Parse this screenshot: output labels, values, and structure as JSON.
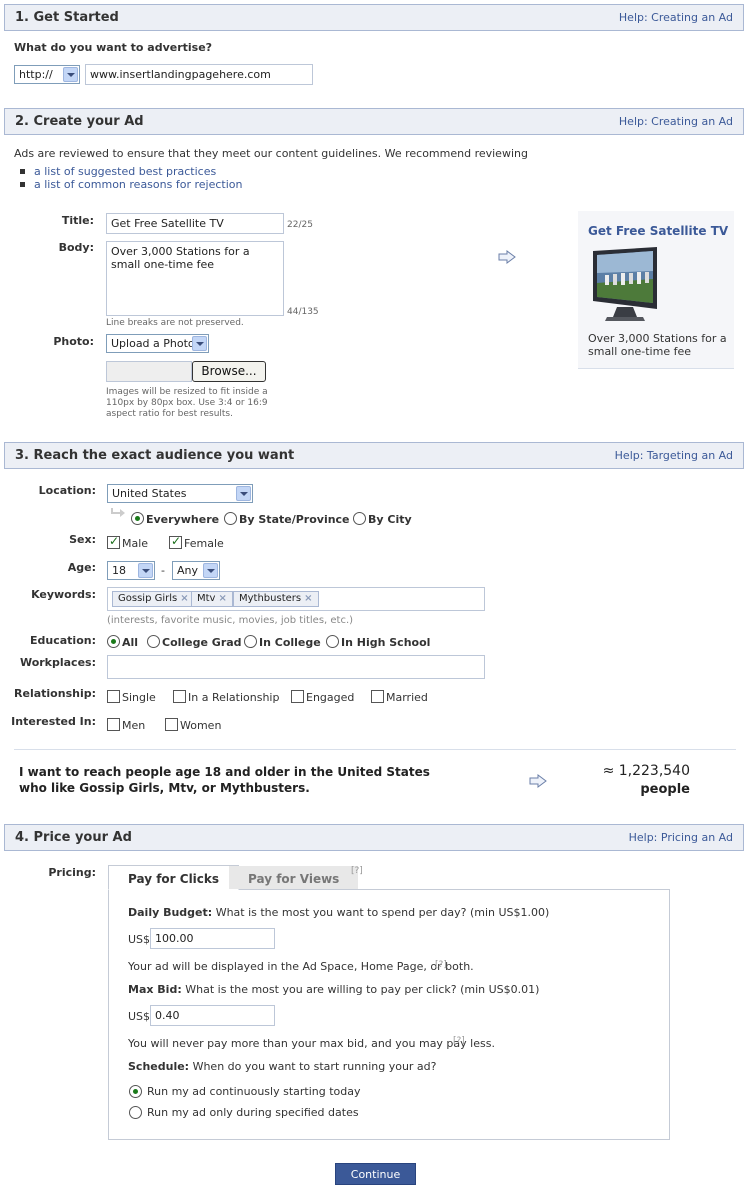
{
  "section1": {
    "title": "1. Get Started",
    "help": "Help: Creating an Ad",
    "question": "What do you want to advertise?",
    "protocol": "http://",
    "url": "www.insertlandingpagehere.com"
  },
  "section2": {
    "title": "2. Create your Ad",
    "help": "Help: Creating an Ad",
    "intro": "Ads are reviewed to ensure that they meet our content guidelines. We recommend reviewing",
    "links": [
      "a list of suggested best practices",
      "a list of common reasons for rejection"
    ],
    "title_label": "Title:",
    "title_value": "Get Free Satellite TV",
    "title_count": "22/25",
    "body_label": "Body:",
    "body_value": "Over 3,000 Stations for a small one-time fee",
    "body_count": "44/135",
    "body_note": "Line breaks are not preserved.",
    "photo_label": "Photo:",
    "photo_select": "Upload a Photo",
    "browse_label": "Browse...",
    "photo_note": "Images will be resized to fit inside a 110px by 80px box. Use 3:4 or 16:9 aspect ratio for best results.",
    "preview_title": "Get Free Satellite TV",
    "preview_body": "Over 3,000 Stations for a small one-time fee"
  },
  "section3": {
    "title": "3. Reach the exact audience you want",
    "help": "Help: Targeting an Ad",
    "location_label": "Location:",
    "location_value": "United States",
    "location_options": [
      "Everywhere",
      "By State/Province",
      "By City"
    ],
    "sex_label": "Sex:",
    "sex_options": [
      "Male",
      "Female"
    ],
    "age_label": "Age:",
    "age_min": "18",
    "age_dash": "-",
    "age_max": "Any",
    "keywords_label": "Keywords:",
    "keywords": [
      "Gossip Girls",
      "Mtv",
      "Mythbusters"
    ],
    "keywords_hint": "(interests, favorite music, movies, job titles, etc.)",
    "education_label": "Education:",
    "education_options": [
      "All",
      "College Grad",
      "In College",
      "In High School"
    ],
    "workplaces_label": "Workplaces:",
    "relationship_label": "Relationship:",
    "relationship_options": [
      "Single",
      "In a Relationship",
      "Engaged",
      "Married"
    ],
    "interested_label": "Interested In:",
    "interested_options": [
      "Men",
      "Women"
    ],
    "summary_line1": "I want to reach people age 18 and older in the United States",
    "summary_line2": "who like Gossip Girls, Mtv, or Mythbusters.",
    "reach_count": "≈ 1,223,540",
    "reach_unit": "people"
  },
  "section4": {
    "title": "4. Price your Ad",
    "help": "Help: Pricing an Ad",
    "pricing_label": "Pricing:",
    "tab_clicks": "Pay for Clicks",
    "tab_views": "Pay for Views",
    "help_mark": "[?]",
    "budget_label": "Daily Budget:",
    "budget_question": "What is the most you want to spend per day?  (min US$1.00)",
    "currency": "US$",
    "budget_value": "100.00",
    "display_note": "Your ad will be displayed in the Ad Space, Home Page, or both.",
    "bid_label": "Max Bid:",
    "bid_question": "What is the most you are willing to pay per click?  (min US$0.01)",
    "bid_value": "0.40",
    "bid_note": "You will never pay more than your max bid, and you may pay less.",
    "schedule_label": "Schedule:",
    "schedule_question": "When do you want to start running your ad?",
    "schedule_options": [
      "Run my ad continuously starting today",
      "Run my ad only during specified dates"
    ],
    "continue_label": "Continue"
  },
  "colors": {
    "link": "#3b5998",
    "header_bg": "#eceff5",
    "header_border": "#aab8d3",
    "button": "#3b5998"
  }
}
